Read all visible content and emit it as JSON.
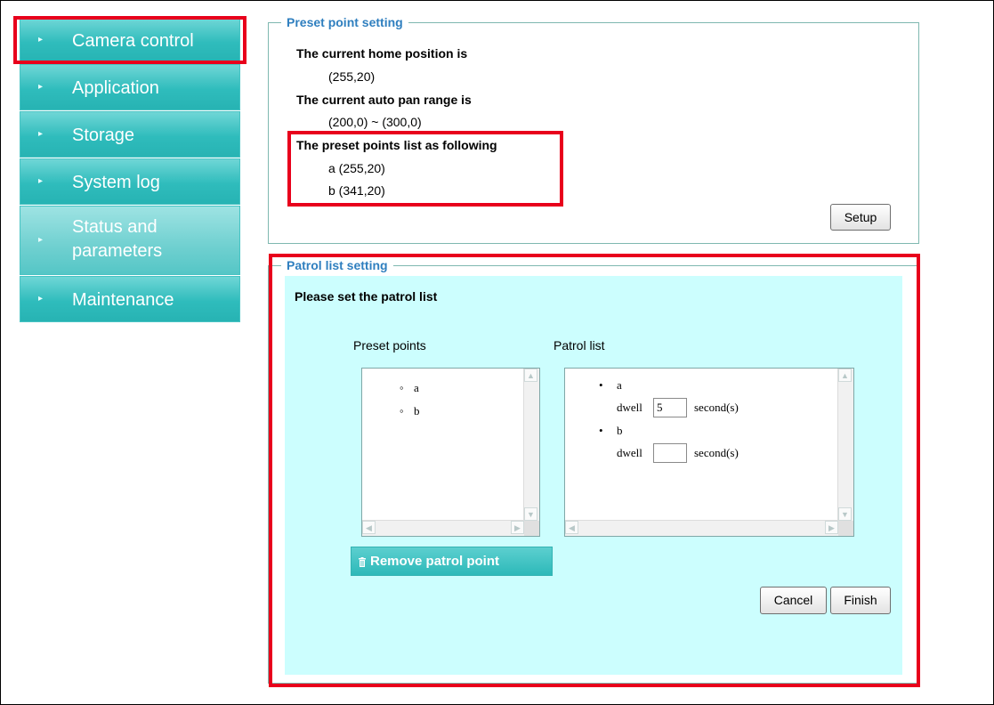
{
  "sidebar": {
    "items": [
      {
        "label": "Camera control"
      },
      {
        "label": "Application"
      },
      {
        "label": "Storage"
      },
      {
        "label": "System log"
      },
      {
        "label_line1": "Status and",
        "label_line2": "parameters"
      },
      {
        "label": "Maintenance"
      }
    ]
  },
  "preset": {
    "legend": "Preset point setting",
    "home_heading": "The current home position is",
    "home_value": "(255,20)",
    "autopan_heading": "The current auto pan range is",
    "autopan_value": "(200,0) ~ (300,0)",
    "list_heading": "The preset points list as following",
    "points": [
      "a (255,20)",
      "b (341,20)"
    ],
    "setup_label": "Setup"
  },
  "patrol": {
    "legend": "Patrol list setting",
    "heading": "Please set the patrol list",
    "preset_points_label": "Preset points",
    "patrol_list_label": "Patrol list",
    "preset_items": [
      "a",
      "b"
    ],
    "patrol_items": [
      {
        "name": "a",
        "dwell_label": "dwell",
        "dwell_value": "5",
        "unit": "second(s)"
      },
      {
        "name": "b",
        "dwell_label": "dwell",
        "dwell_value": "",
        "unit": "second(s)"
      }
    ],
    "remove_label": "Remove patrol point",
    "cancel_label": "Cancel",
    "finish_label": "Finish"
  },
  "colors": {
    "highlight": "#e8001c",
    "nav_teal": "#2fbcbc",
    "legend_blue": "#2f7fbf",
    "patrol_bg": "#ccfefe"
  }
}
